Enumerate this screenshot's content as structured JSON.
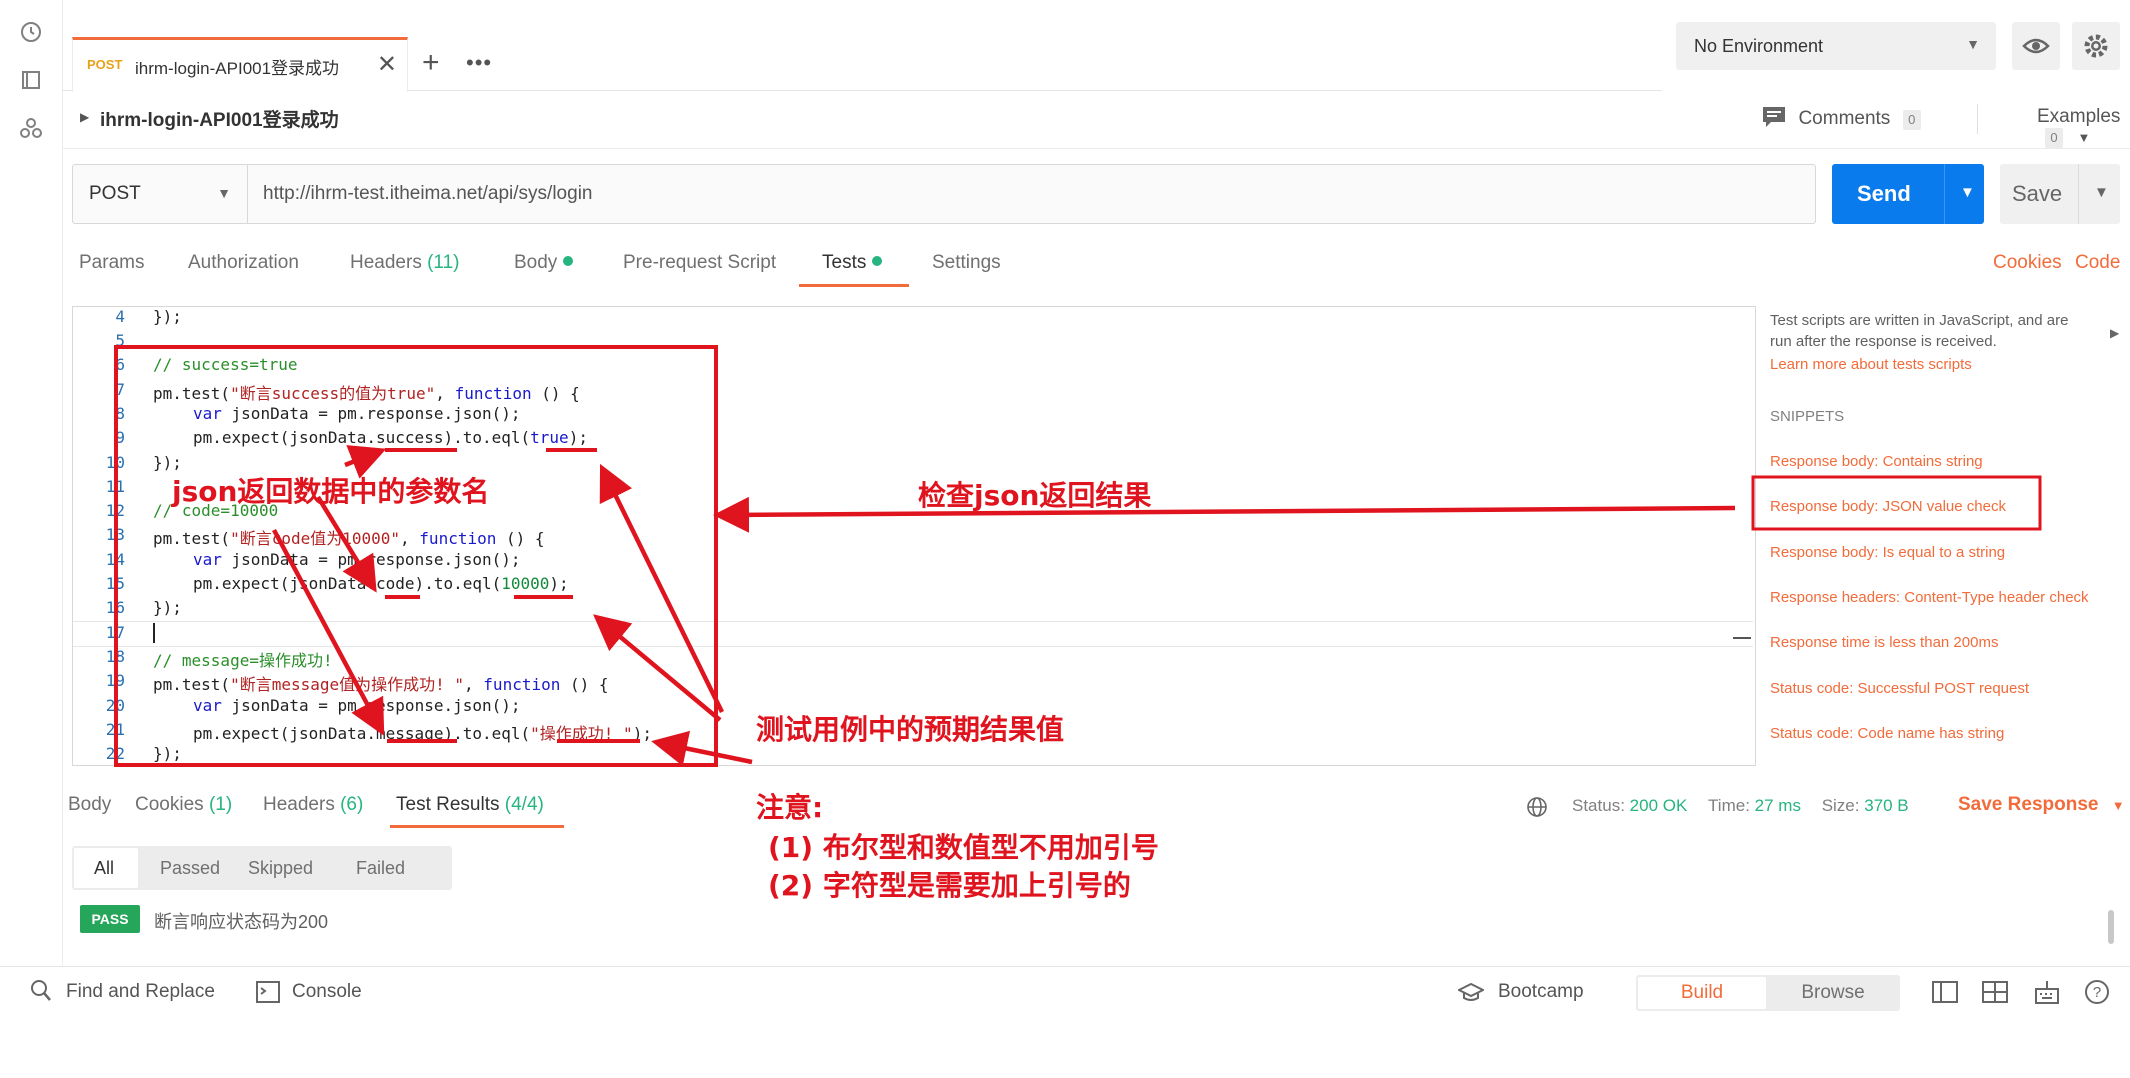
{
  "tab": {
    "method": "POST",
    "name": "ihrm-login-API001登录成功"
  },
  "environment": {
    "selected": "No Environment"
  },
  "request": {
    "title": "ihrm-login-API001登录成功",
    "comments_label": "Comments",
    "comments_count": "0",
    "examples_label": "Examples",
    "examples_count": "0",
    "method": "POST",
    "url": "http://ihrm-test.itheima.net/api/sys/login",
    "send_label": "Send",
    "save_label": "Save"
  },
  "request_tabs": {
    "params": "Params",
    "authorization": "Authorization",
    "headers": "Headers",
    "headers_count": "(11)",
    "body": "Body",
    "prerequest": "Pre-request Script",
    "tests": "Tests",
    "settings": "Settings",
    "cookies": "Cookies",
    "code": "Code"
  },
  "editor": {
    "line_numbers": [
      "4",
      "5",
      "6",
      "7",
      "8",
      "9",
      "10",
      "11",
      "12",
      "13",
      "14",
      "15",
      "16",
      "17",
      "18",
      "19",
      "20",
      "21",
      "22"
    ],
    "l4": "});",
    "l6_comment": "// success=true",
    "l7_a": "pm.test(",
    "l7_str": "\"断言success的值为true\"",
    "l7_b": ", ",
    "l7_kw": "function",
    "l7_c": " () {",
    "l8_kw": "var",
    "l8_rest": " jsonData = pm.response.json();",
    "l9_a": "pm.expect(jsonData.success).to.eql(",
    "l9_val": "true",
    "l9_b": ");",
    "l10": "});",
    "l12_comment": "// code=10000",
    "l13_a": "pm.test(",
    "l13_str": "\"断言code值为10000\"",
    "l13_b": ", ",
    "l13_kw": "function",
    "l13_c": " () {",
    "l14_kw": "var",
    "l14_rest": " jsonData = pm.response.json();",
    "l15_a": "pm.expect(jsonData.code).to.eql(",
    "l15_val": "10000",
    "l15_b": ");",
    "l16": "});",
    "l18_comment": "// message=操作成功!",
    "l19_a": "pm.test(",
    "l19_str": "\"断言message值为操作成功! \"",
    "l19_b": ", ",
    "l19_kw": "function",
    "l19_c": " () {",
    "l20_kw": "var",
    "l20_rest": " jsonData = pm.response.json();",
    "l21_a": "pm.expect(jsonData.message).to.eql(",
    "l21_val": "\"操作成功! \"",
    "l21_b": ");",
    "l22": "});"
  },
  "side": {
    "intro_1": "Test scripts are written in JavaScript, and are",
    "intro_2": "run after the response is received.",
    "learn": "Learn more about tests scripts",
    "snippets_heading": "SNIPPETS",
    "snippets": [
      "Response body: Contains string",
      "Response body: JSON value check",
      "Response body: Is equal to a string",
      "Response headers: Content-Type header check",
      "Response time is less than 200ms",
      "Status code: Successful POST request",
      "Status code: Code name has string"
    ]
  },
  "response": {
    "tabs": {
      "body": "Body",
      "cookies": "Cookies",
      "cookies_count": "(1)",
      "headers": "Headers",
      "headers_count": "(6)",
      "tests": "Test Results",
      "tests_count": "(4/4)"
    },
    "status_label": "Status:",
    "status_value": "200 OK",
    "time_label": "Time:",
    "time_value": "27 ms",
    "size_label": "Size:",
    "size_value": "370 B",
    "save_response": "Save Response",
    "filters": [
      "All",
      "Passed",
      "Skipped",
      "Failed"
    ],
    "result_badge": "PASS",
    "result_text": "断言响应状态码为200"
  },
  "footer": {
    "find_replace": "Find and Replace",
    "console": "Console",
    "bootcamp": "Bootcamp",
    "build": "Build",
    "browse": "Browse"
  },
  "annotations": {
    "param_name": "json返回数据中的参数名",
    "check_result": "检查json返回结果",
    "expected_value": "测试用例中的预期结果值",
    "note_title": "注意:",
    "note_1": "(1) 布尔型和数值型不用加引号",
    "note_2": "(2) 字符型是需要加上引号的"
  },
  "colors": {
    "accent": "#f26b3a",
    "send": "#097bed",
    "pass": "#26a65b",
    "annotation": "#e0141e"
  }
}
